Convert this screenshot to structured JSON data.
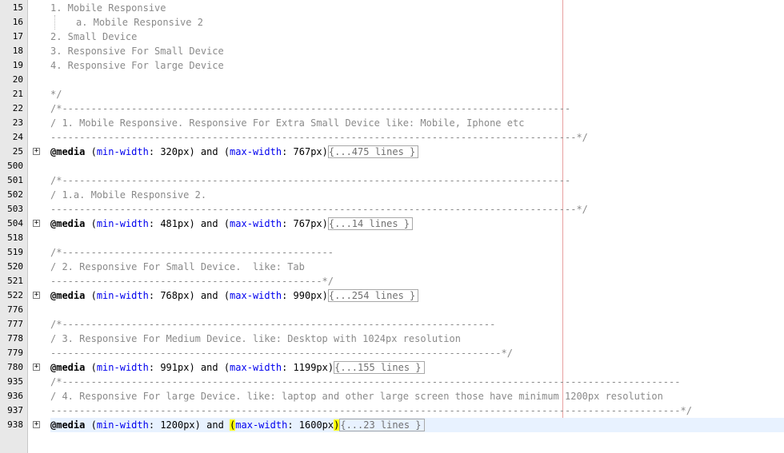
{
  "editor": {
    "lines": [
      {
        "n": "15",
        "kind": "comment",
        "text": "1. Mobile Responsive"
      },
      {
        "n": "16",
        "kind": "comment-sub",
        "text": "a. Mobile Responsive 2"
      },
      {
        "n": "17",
        "kind": "comment",
        "text": "2. Small Device"
      },
      {
        "n": "18",
        "kind": "comment",
        "text": "3. Responsive For Small Device"
      },
      {
        "n": "19",
        "kind": "comment",
        "text": "4. Responsive For large Device"
      },
      {
        "n": "20",
        "kind": "blank",
        "text": ""
      },
      {
        "n": "21",
        "kind": "comment",
        "text": "*/"
      },
      {
        "n": "22",
        "kind": "comment",
        "text": "/*----------------------------------------------------------------------------------------"
      },
      {
        "n": "23",
        "kind": "comment",
        "text": "/ 1. Mobile Responsive. Responsive For Extra Small Device like: Mobile, Iphone etc"
      },
      {
        "n": "24",
        "kind": "comment",
        "text": "-------------------------------------------------------------------------------------------*/"
      },
      {
        "n": "25",
        "kind": "media",
        "min": "320px",
        "max": "767px",
        "collapsed": "{...475 lines }"
      },
      {
        "n": "500",
        "kind": "blank",
        "text": ""
      },
      {
        "n": "501",
        "kind": "comment",
        "text": "/*----------------------------------------------------------------------------------------"
      },
      {
        "n": "502",
        "kind": "comment",
        "text": "/ 1.a. Mobile Responsive 2."
      },
      {
        "n": "503",
        "kind": "comment",
        "text": "-------------------------------------------------------------------------------------------*/"
      },
      {
        "n": "504",
        "kind": "media",
        "min": "481px",
        "max": "767px",
        "collapsed": "{...14 lines }"
      },
      {
        "n": "518",
        "kind": "blank",
        "text": ""
      },
      {
        "n": "519",
        "kind": "comment",
        "text": "/*-----------------------------------------------"
      },
      {
        "n": "520",
        "kind": "comment",
        "text": "/ 2. Responsive For Small Device.  like: Tab"
      },
      {
        "n": "521",
        "kind": "comment",
        "text": "-----------------------------------------------*/"
      },
      {
        "n": "522",
        "kind": "media",
        "min": "768px",
        "max": "990px",
        "collapsed": "{...254 lines }"
      },
      {
        "n": "776",
        "kind": "blank",
        "text": ""
      },
      {
        "n": "777",
        "kind": "comment",
        "text": "/*---------------------------------------------------------------------------"
      },
      {
        "n": "778",
        "kind": "comment",
        "text": "/ 3. Responsive For Medium Device. like: Desktop with 1024px resolution"
      },
      {
        "n": "779",
        "kind": "comment",
        "text": "------------------------------------------------------------------------------*/"
      },
      {
        "n": "780",
        "kind": "media",
        "min": "991px",
        "max": "1199px",
        "collapsed": "{...155 lines }"
      },
      {
        "n": "935",
        "kind": "comment",
        "text": "/*-----------------------------------------------------------------------------------------------------------"
      },
      {
        "n": "936",
        "kind": "comment",
        "text": "/ 4. Responsive For large Device. like: laptop and other large screen those have minimum 1200px resolution"
      },
      {
        "n": "937",
        "kind": "comment",
        "text": "-------------------------------------------------------------------------------------------------------------*/"
      },
      {
        "n": "938",
        "kind": "media",
        "min": "1200px",
        "max": "1600px",
        "collapsed": "{...23 lines }",
        "current": true
      }
    ],
    "tokens": {
      "at_media": "@media",
      "min_prop": "min-width",
      "max_prop": "max-width",
      "and": "and",
      "fold_glyph": "+"
    }
  }
}
